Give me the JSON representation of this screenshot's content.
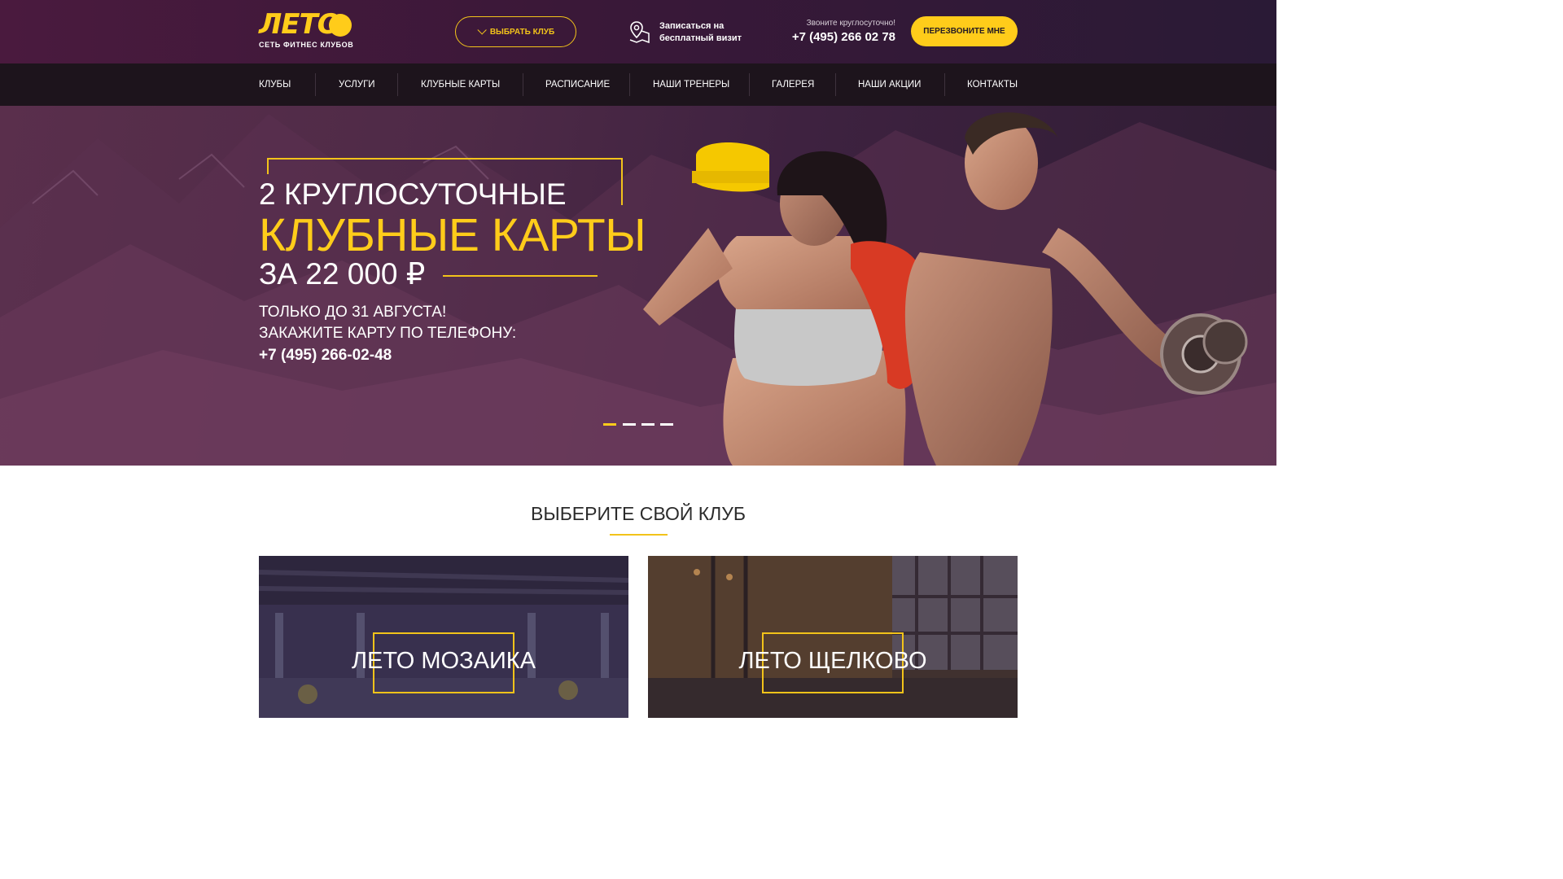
{
  "header": {
    "logo_text": "ЛЕТО",
    "logo_subtitle": "СЕТЬ ФИТНЕС КЛУБОВ",
    "choose_club_label": "ВЫБРАТЬ КЛУБ",
    "visit_line1": "Записаться на",
    "visit_line2": "бесплатный визит",
    "call_label": "Звоните круглосуточно!",
    "phone": "+7 (495) 266 02 78",
    "callback_label": "ПЕРЕЗВОНИТЕ МНЕ"
  },
  "nav": {
    "items": [
      "КЛУБЫ",
      "УСЛУГИ",
      "КЛУБНЫЕ КАРТЫ",
      "РАСПИСАНИЕ",
      "НАШИ ТРЕНЕРЫ",
      "ГАЛЕРЕЯ",
      "НАШИ АКЦИИ",
      "КОНТАКТЫ"
    ]
  },
  "hero": {
    "line1": "2 КРУГЛОСУТОЧНЫЕ",
    "line2": "КЛУБНЫЕ КАРТЫ",
    "line3": "ЗА 22 000 ₽",
    "promo1": "ТОЛЬКО ДО 31 АВГУСТА!",
    "promo2": "ЗАКАЖИТЕ КАРТУ ПО ТЕЛЕФОНУ:",
    "promo_phone": "+7 (495) 266-02-48",
    "slides": 4,
    "active_slide": 1
  },
  "clubs_section": {
    "title": "ВЫБЕРИТЕ СВОЙ КЛУБ",
    "clubs": [
      {
        "name": "ЛЕТО МОЗАИКА"
      },
      {
        "name": "ЛЕТО ЩЕЛКОВО"
      }
    ]
  },
  "colors": {
    "accent": "#ffcc1a",
    "header_bg": "#3a1838",
    "nav_bg": "#1d141c"
  },
  "icons": {
    "visit": "map-pin-icon",
    "choose_club": "chevron-down-icon"
  }
}
